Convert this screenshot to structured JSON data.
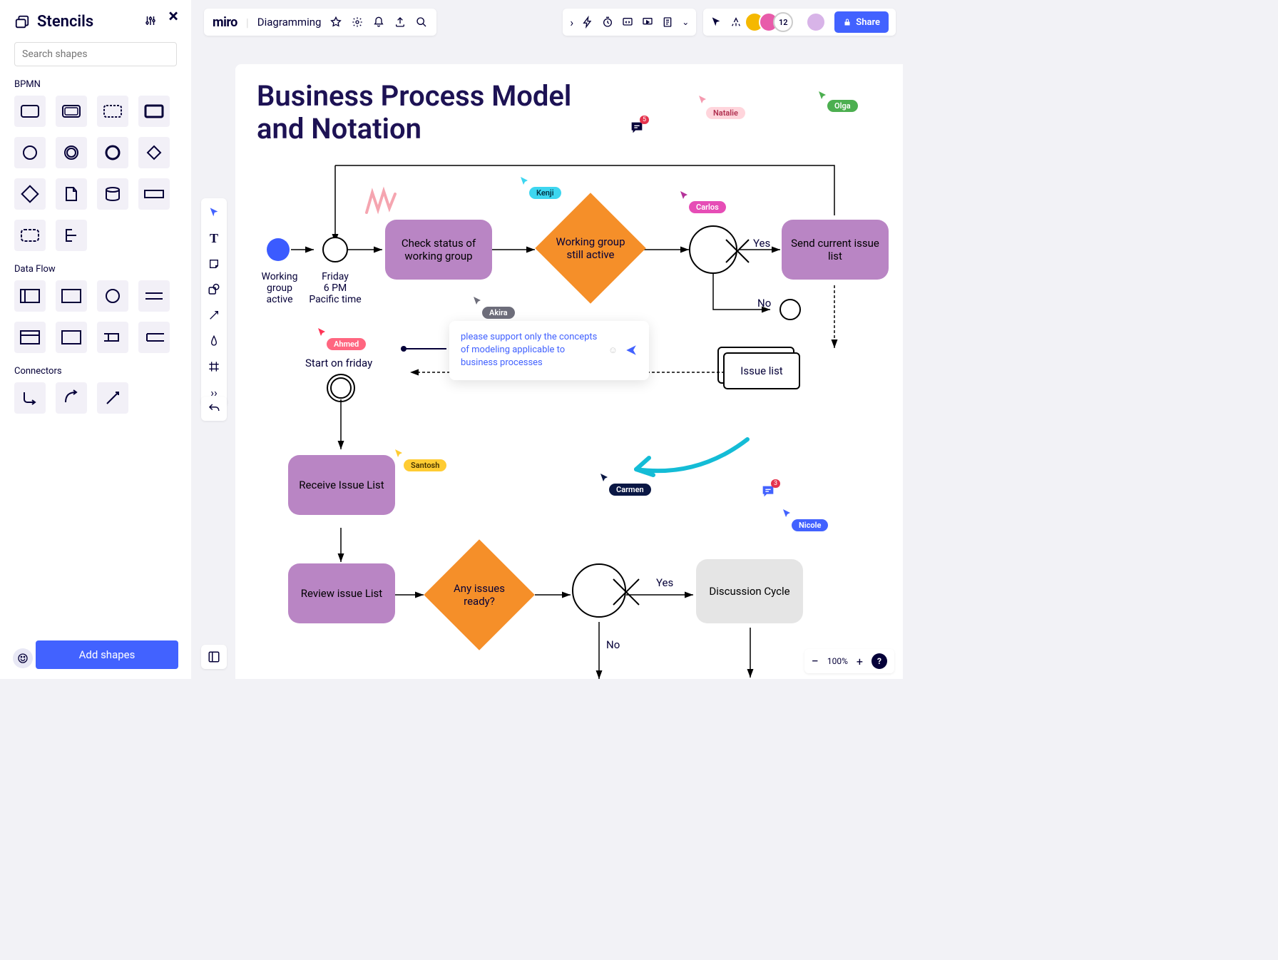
{
  "sidebar": {
    "title": "Stencils",
    "search_placeholder": "Search shapes",
    "cat1": "BPMN",
    "cat2": "Data Flow",
    "cat3": "Connectors",
    "add_btn": "Add shapes"
  },
  "header": {
    "brand": "miro",
    "board": "Diagramming",
    "presence_count": "12",
    "share": "Share"
  },
  "diagram": {
    "title": "Business Process Model\nand Notation",
    "n1a": "Working",
    "n1b": "group",
    "n1c": "active",
    "n2a": "Friday",
    "n2b": "6 PM",
    "n2c": "Pacific time",
    "n3": "Check status of working group",
    "n4": "Working group still active",
    "edge_yes": "Yes",
    "edge_no": "No",
    "n5": "Send current issue list",
    "n6": "Issue list",
    "n7": "Start on friday",
    "n8": "Receive Issue List",
    "n9": "Review issue List",
    "n10": "Any issues ready?",
    "n11": "Discussion Cycle",
    "edge_yes2": "Yes",
    "edge_no2": "No"
  },
  "comments": {
    "c1_text": "please support only the concepts of modeling applicable to business processes",
    "badge1": "5",
    "badge2": "3"
  },
  "cursors": {
    "natalie": "Natalie",
    "olga": "Olga",
    "kenji": "Kenji",
    "carlos": "Carlos",
    "akira": "Akira",
    "ahmed": "Ahmed",
    "santosh": "Santosh",
    "carmen": "Carmen",
    "nicole": "Nicole"
  },
  "zoom": {
    "level": "100%"
  }
}
